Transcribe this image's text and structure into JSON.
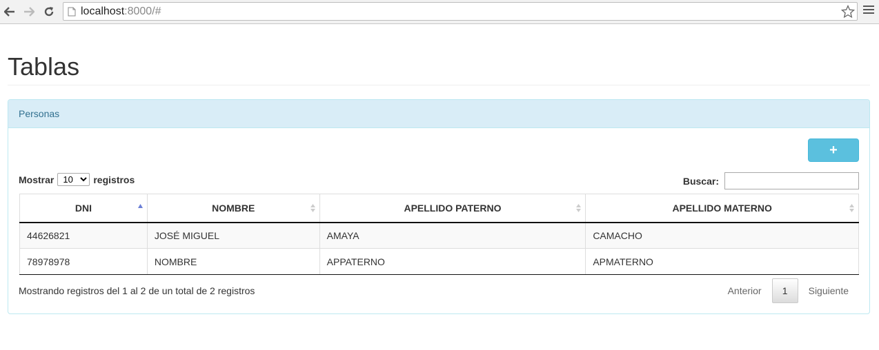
{
  "browser": {
    "url_host": "localhost",
    "url_rest": ":8000/#"
  },
  "page": {
    "title": "Tablas"
  },
  "panel": {
    "heading": "Personas",
    "add_button_icon": "plus-icon",
    "add_button_label": "+",
    "length": {
      "prefix": "Mostrar",
      "selected": "10",
      "suffix": "registros"
    },
    "search": {
      "label": "Buscar:",
      "value": ""
    },
    "table": {
      "columns": [
        "DNI",
        "NOMBRE",
        "APELLIDO PATERNO",
        "APELLIDO MATERNO"
      ],
      "rows": [
        [
          "44626821",
          "JOSÉ MIGUEL",
          "AMAYA",
          "CAMACHO"
        ],
        [
          "78978978",
          "NOMBRE",
          "APPATERNO",
          "APMATERNO"
        ]
      ]
    },
    "info": "Mostrando registros del 1 al 2 de un total de 2 registros",
    "pagination": {
      "previous": "Anterior",
      "current": "1",
      "next": "Siguiente"
    }
  },
  "colors": {
    "panel_heading_bg": "#d9edf7",
    "panel_heading_text": "#31708f",
    "add_button_bg": "#5bc0de"
  }
}
